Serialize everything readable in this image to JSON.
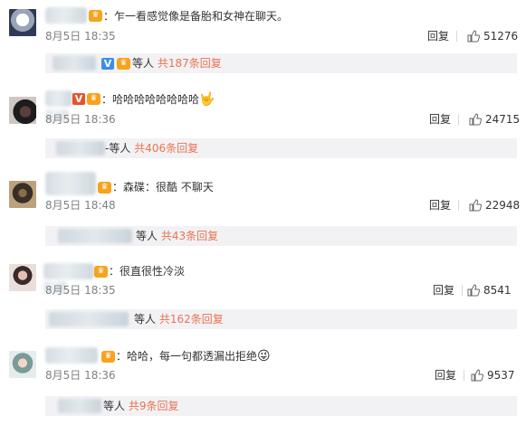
{
  "comments": [
    {
      "text": "：乍一看感觉像是备胎和女神在聊天。",
      "emoji": "",
      "date": "8月5日 18:35",
      "reply": "回复",
      "likes": "51276",
      "sub_who": "等人",
      "sub_link": "共187条回复"
    },
    {
      "text": "：哈哈哈哈哈哈哈哈",
      "emoji": "🤟",
      "date": "8月5日 18:36",
      "reply": "回复",
      "likes": "24715",
      "sub_who": "等人",
      "sub_link": "共406条回复"
    },
    {
      "text": "：森碟：很酷 不聊天",
      "emoji": "",
      "date": "8月5日 18:48",
      "reply": "回复",
      "likes": "22948",
      "sub_who": "等人",
      "sub_link": "共43条回复"
    },
    {
      "text": "：很直很性冷淡",
      "emoji": "",
      "date": "8月5日 18:35",
      "reply": "回复",
      "likes": "8541",
      "sub_who": "等人",
      "sub_link": "共162条回复"
    },
    {
      "text": "：哈哈，每一句都透漏出拒绝",
      "emoji": "😜",
      "date": "8月5日 18:36",
      "reply": "回复",
      "likes": "9537",
      "sub_who": "等人",
      "sub_link": "共9条回复"
    }
  ],
  "icons": {
    "like": "thumbs-up-icon",
    "vip": "vip-crown-icon",
    "verified": "verified-v-icon"
  },
  "colors": {
    "link": "#eb7350",
    "meta": "#808080",
    "sub_bg": "#f2f2f5",
    "vip": "#f7a31c"
  }
}
